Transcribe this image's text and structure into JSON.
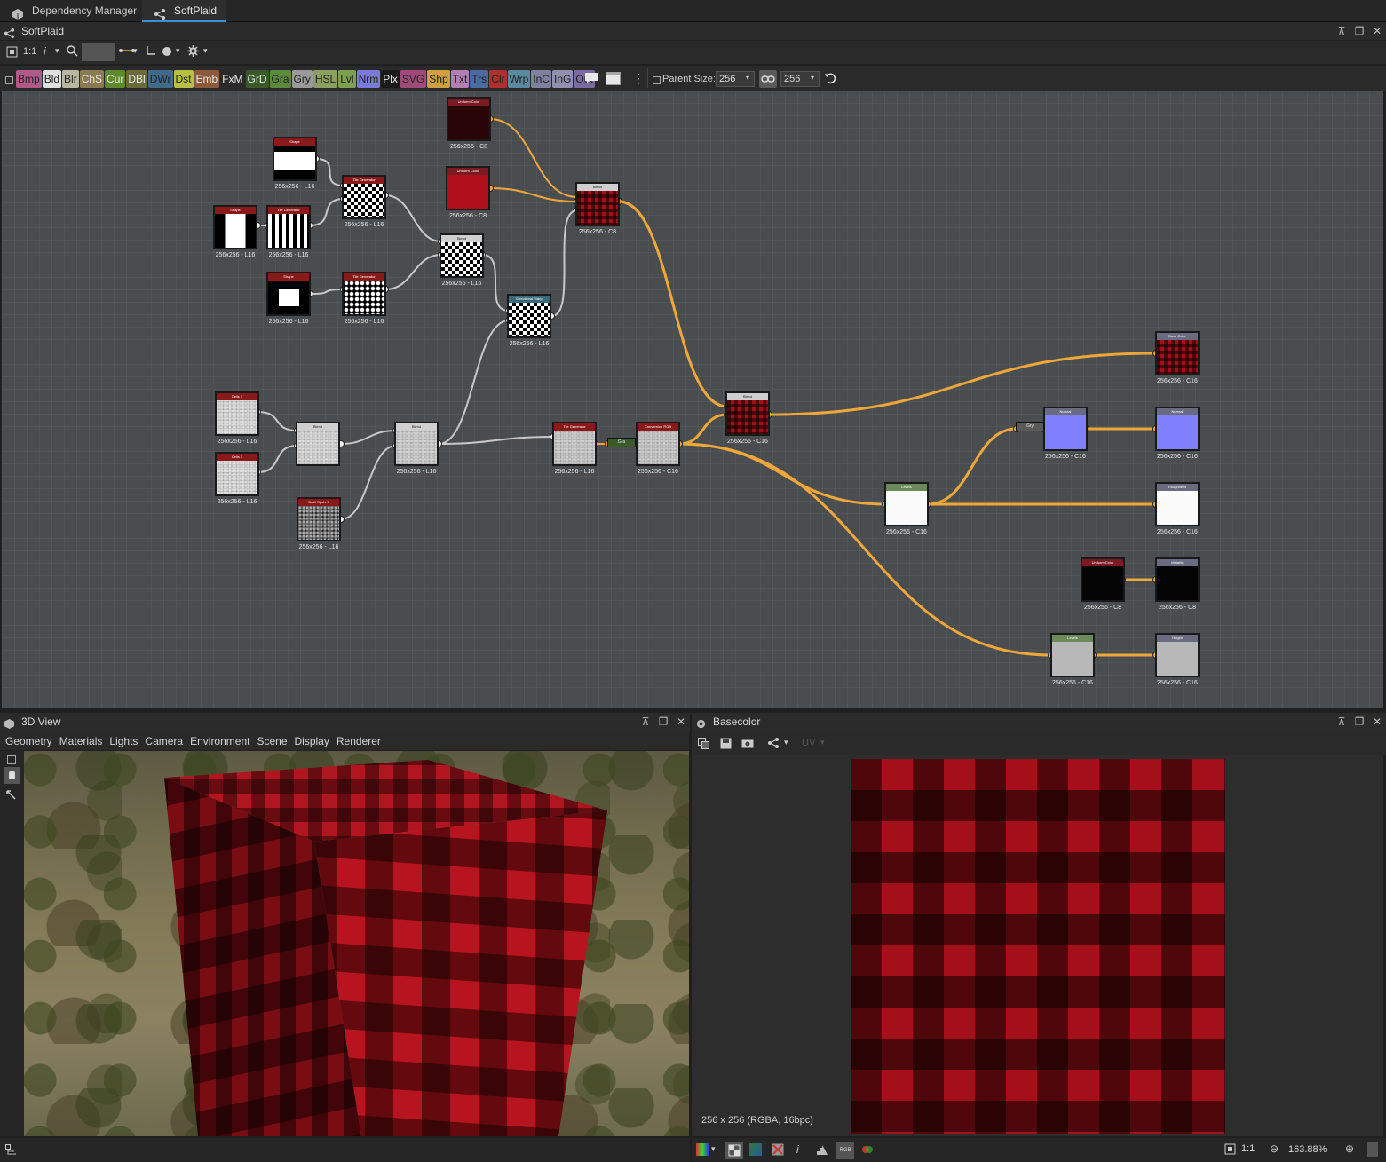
{
  "tabs": [
    {
      "label": "Dependency Manager",
      "active": false
    },
    {
      "label": "SoftPlaid",
      "active": true
    }
  ],
  "graph_panel": {
    "title": "SoftPlaid",
    "zoom_label": "1:1",
    "info_label": "i"
  },
  "filters": [
    {
      "label": "Bmp",
      "color": "#b05a8a"
    },
    {
      "label": "Bld",
      "color": "#e0e0e0"
    },
    {
      "label": "Blr",
      "color": "#b8b8a0"
    },
    {
      "label": "ChS",
      "color": "#8a7a52"
    },
    {
      "label": "Cur",
      "color": "#5c8a2a"
    },
    {
      "label": "DBl",
      "color": "#6a6a3a"
    },
    {
      "label": "DWr",
      "color": "#3f6a8a"
    },
    {
      "label": "Dst",
      "color": "#b8c040"
    },
    {
      "label": "Emb",
      "color": "#8a5a3a"
    },
    {
      "label": "FxM",
      "color": "#2a2a2a"
    },
    {
      "label": "GrD",
      "color": "#3a5a2a"
    },
    {
      "label": "Gra",
      "color": "#5a8a3a"
    },
    {
      "label": "Gry",
      "color": "#9a9a9a"
    },
    {
      "label": "HSL",
      "color": "#8aa060"
    },
    {
      "label": "Lvl",
      "color": "#7aa050"
    },
    {
      "label": "Nrm",
      "color": "#7a7ad8"
    },
    {
      "label": "Plx",
      "color": "#1a1a1a"
    },
    {
      "label": "SVG",
      "color": "#a04a7a"
    },
    {
      "label": "Shp",
      "color": "#d0a040"
    },
    {
      "label": "Txt",
      "color": "#b080b0"
    },
    {
      "label": "Trs",
      "color": "#4a6aa0"
    },
    {
      "label": "Clr",
      "color": "#b03030"
    },
    {
      "label": "Wrp",
      "color": "#5a8aa0"
    },
    {
      "label": "InC",
      "color": "#8080a0"
    },
    {
      "label": "InG",
      "color": "#9090b0"
    },
    {
      "label": "Out",
      "color": "#7a6aa0"
    }
  ],
  "parent_size": {
    "label": "Parent Size:",
    "width": "256",
    "height": "256"
  },
  "nodes": [
    {
      "name": "Uniform Color",
      "label": "256x256 - C8",
      "header": "#7a1a22",
      "fill": "#2a0508",
      "preview": "solid"
    },
    {
      "name": "Uniform Color",
      "label": "256x256 - C8",
      "header": "#7a1a22",
      "fill": "#b00f1c",
      "preview": "solid"
    },
    {
      "name": "Shape",
      "label": "256x256 - L16",
      "header": "#8a1a1a",
      "fill": "#fff",
      "preview": "bar"
    },
    {
      "name": "Tile Generator",
      "label": "256x256 - L16",
      "header": "#8a1a1a",
      "fill": "#fff",
      "preview": "checker"
    },
    {
      "name": "Blend",
      "label": "256x256 - C8",
      "header": "#cfcfcf",
      "fill": "#a3101a",
      "preview": "plaid"
    },
    {
      "name": "Shape",
      "label": "256x256 - L16",
      "header": "#8a1a1a",
      "fill": "#fff",
      "preview": "vbar"
    },
    {
      "name": "Tile Generator",
      "label": "256x256 - L16",
      "header": "#8a1a1a",
      "fill": "#fff",
      "preview": "stripes"
    },
    {
      "name": "Blend",
      "label": "256x256 - L16",
      "header": "#cfcfcf",
      "fill": "#fff",
      "preview": "checker"
    },
    {
      "name": "Shape",
      "label": "256x256 - L16",
      "header": "#8a1a1a",
      "fill": "#fff",
      "preview": "square"
    },
    {
      "name": "Tile Generator",
      "label": "256x256 - L16",
      "header": "#8a1a1a",
      "fill": "#fff",
      "preview": "dots"
    },
    {
      "name": "Directional Warp",
      "label": "256x256 - L16",
      "header": "#3a6a7a",
      "fill": "#fff",
      "preview": "checker"
    },
    {
      "name": "Cells 1",
      "label": "256x256 - L16",
      "header": "#8a1a1a",
      "fill": "#e8e8e8",
      "preview": "noise"
    },
    {
      "name": "Cells 1",
      "label": "256x256 - L16",
      "header": "#8a1a1a",
      "fill": "#e8e8e8",
      "preview": "noise"
    },
    {
      "name": "Blend",
      "label": "",
      "header": "#cfcfcf",
      "fill": "#e8e8e8",
      "preview": "noise"
    },
    {
      "name": "Blend",
      "label": "256x256 - L16",
      "header": "#cfcfcf",
      "fill": "#dcdcdc",
      "preview": "noise"
    },
    {
      "name": "BnW Spots 3",
      "label": "256x256 - L16",
      "header": "#8a1a1a",
      "fill": "#7a7a7a",
      "preview": "spots"
    },
    {
      "name": "Tile Generator",
      "label": "256x256 - L16",
      "header": "#8a1a1a",
      "fill": "#d8d8d8",
      "preview": "noise"
    },
    {
      "name": "Conversion RGB",
      "label": "256x256 - C16",
      "header": "#8a1a1a",
      "fill": "#d8d8d8",
      "preview": "noise"
    },
    {
      "name": "Blend",
      "label": "256x256 - C16",
      "header": "#cfcfcf",
      "fill": "#a3101a",
      "preview": "plaid"
    },
    {
      "name": "Base Color",
      "label": "256x256 - C16",
      "header": "#6a6a80",
      "fill": "#a3101a",
      "preview": "plaid"
    },
    {
      "name": "Normal",
      "label": "256x256 - C16",
      "header": "#6a6a80",
      "fill": "#8080ff",
      "preview": "solid"
    },
    {
      "name": "Normal",
      "label": "256x256 - C16",
      "header": "#6a6a80",
      "fill": "#8080ff",
      "preview": "solid"
    },
    {
      "name": "Levels",
      "label": "256x256 - C16",
      "header": "#6a8a5a",
      "fill": "#fafafa",
      "preview": "solid"
    },
    {
      "name": "Roughness",
      "label": "256x256 - C16",
      "header": "#6a6a80",
      "fill": "#fafafa",
      "preview": "solid"
    },
    {
      "name": "Uniform Color",
      "label": "256x256 - C8",
      "header": "#7a1a22",
      "fill": "#050505",
      "preview": "solid"
    },
    {
      "name": "Metallic",
      "label": "256x256 - C8",
      "header": "#6a6a80",
      "fill": "#050505",
      "preview": "solid"
    },
    {
      "name": "Levels",
      "label": "256x256 - C16",
      "header": "#6a8a5a",
      "fill": "#b8b8b8",
      "preview": "solid"
    },
    {
      "name": "Height",
      "label": "256x256 - C16",
      "header": "#6a6a80",
      "fill": "#b8b8b8",
      "preview": "solid"
    }
  ],
  "small_nodes": [
    {
      "name": "Gra",
      "color": "#3a5a2a"
    },
    {
      "name": "Gry",
      "color": "#5a5a5a"
    }
  ],
  "view3d": {
    "title": "3D View",
    "menu": [
      "Geometry",
      "Materials",
      "Lights",
      "Camera",
      "Environment",
      "Scene",
      "Display",
      "Renderer"
    ]
  },
  "basecolor": {
    "title": "Basecolor",
    "uv_label": "UV",
    "resolution": "256 x 256 (RGBA, 16bpc)",
    "zoom_ratio": "1:1",
    "zoom_percent": "163.88%"
  },
  "colors": {
    "accent": "#3a8fd6",
    "orange_link": "#f0a73a",
    "grey_link": "#c8c8c8"
  }
}
